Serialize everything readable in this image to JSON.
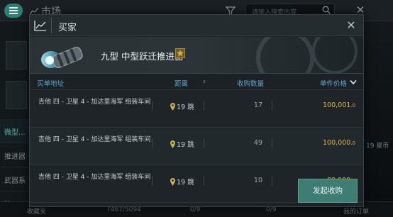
{
  "background": {
    "title": "市场",
    "search_placeholder": "请输入搜索内容",
    "categories": [
      "微型...",
      "推进器",
      "武器系",
      "防..."
    ],
    "bottom_left": "收藏夹",
    "bottom_mid1": "7467/5094",
    "bottom_mid2": "0/9",
    "bottom_mid3": "0/9",
    "bottom_right": "我的订单",
    "right_hint": "19 星币"
  },
  "dialog": {
    "title": "买家",
    "item_name": "九型 中型跃迁推进器",
    "columns": {
      "location": "买单地址",
      "distance": "距离",
      "quantity": "收购数量",
      "price": "单件价格"
    },
    "rows": [
      {
        "location": "吉他 四 - 卫星 4 - 加达里海军 组装车间",
        "distance": "19 跳",
        "quantity": "17",
        "price": "100,001",
        "decimals": ".0"
      },
      {
        "location": "吉他 四 - 卫星 4 - 加达里海军 组装车间",
        "distance": "19 跳",
        "quantity": "49",
        "price": "100,000",
        "decimals": ".0"
      },
      {
        "location": "吉他 四 - 卫星 4 - 加达里海军 组装车间",
        "distance": "19 跳",
        "quantity": "10",
        "price": "89,999",
        "decimals": ".0"
      }
    ],
    "buy_button": "发起收购"
  },
  "colors": {
    "accent": "#3f7c73",
    "price": "#d7b54a",
    "header_text": "#5fa7c9"
  }
}
